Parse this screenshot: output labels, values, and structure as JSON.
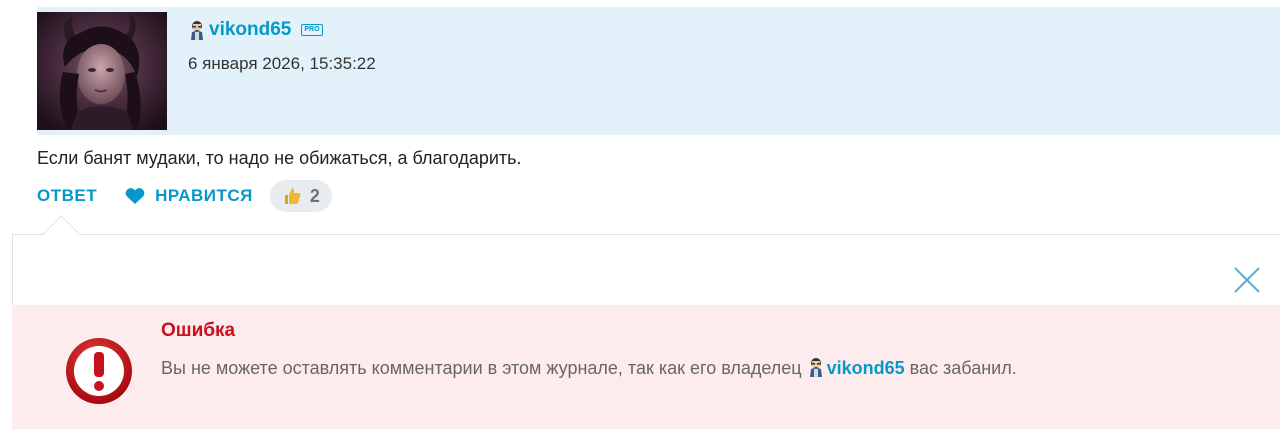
{
  "post": {
    "username": "vikond65",
    "pro_badge": "PRO",
    "date": "6 января 2026, 15:35:22",
    "avatar_icon": "user-avatar-photo",
    "text": "Если банят мудаки, то надо не обижаться, а благодарить."
  },
  "actions": {
    "reply_label": "ОТВЕТ",
    "like_label": "НРАВИТСЯ",
    "like_count": "2"
  },
  "error": {
    "title": "Ошибка",
    "text_before": "Вы не можете оставлять комментарии в этом журнале, так как его владелец ",
    "username": "vikond65",
    "text_after": " вас забанил."
  },
  "colors": {
    "accent": "#0598c9",
    "header_bg": "#e3f2fa",
    "error_bg": "#fdeced",
    "error_title": "#c8101f"
  }
}
